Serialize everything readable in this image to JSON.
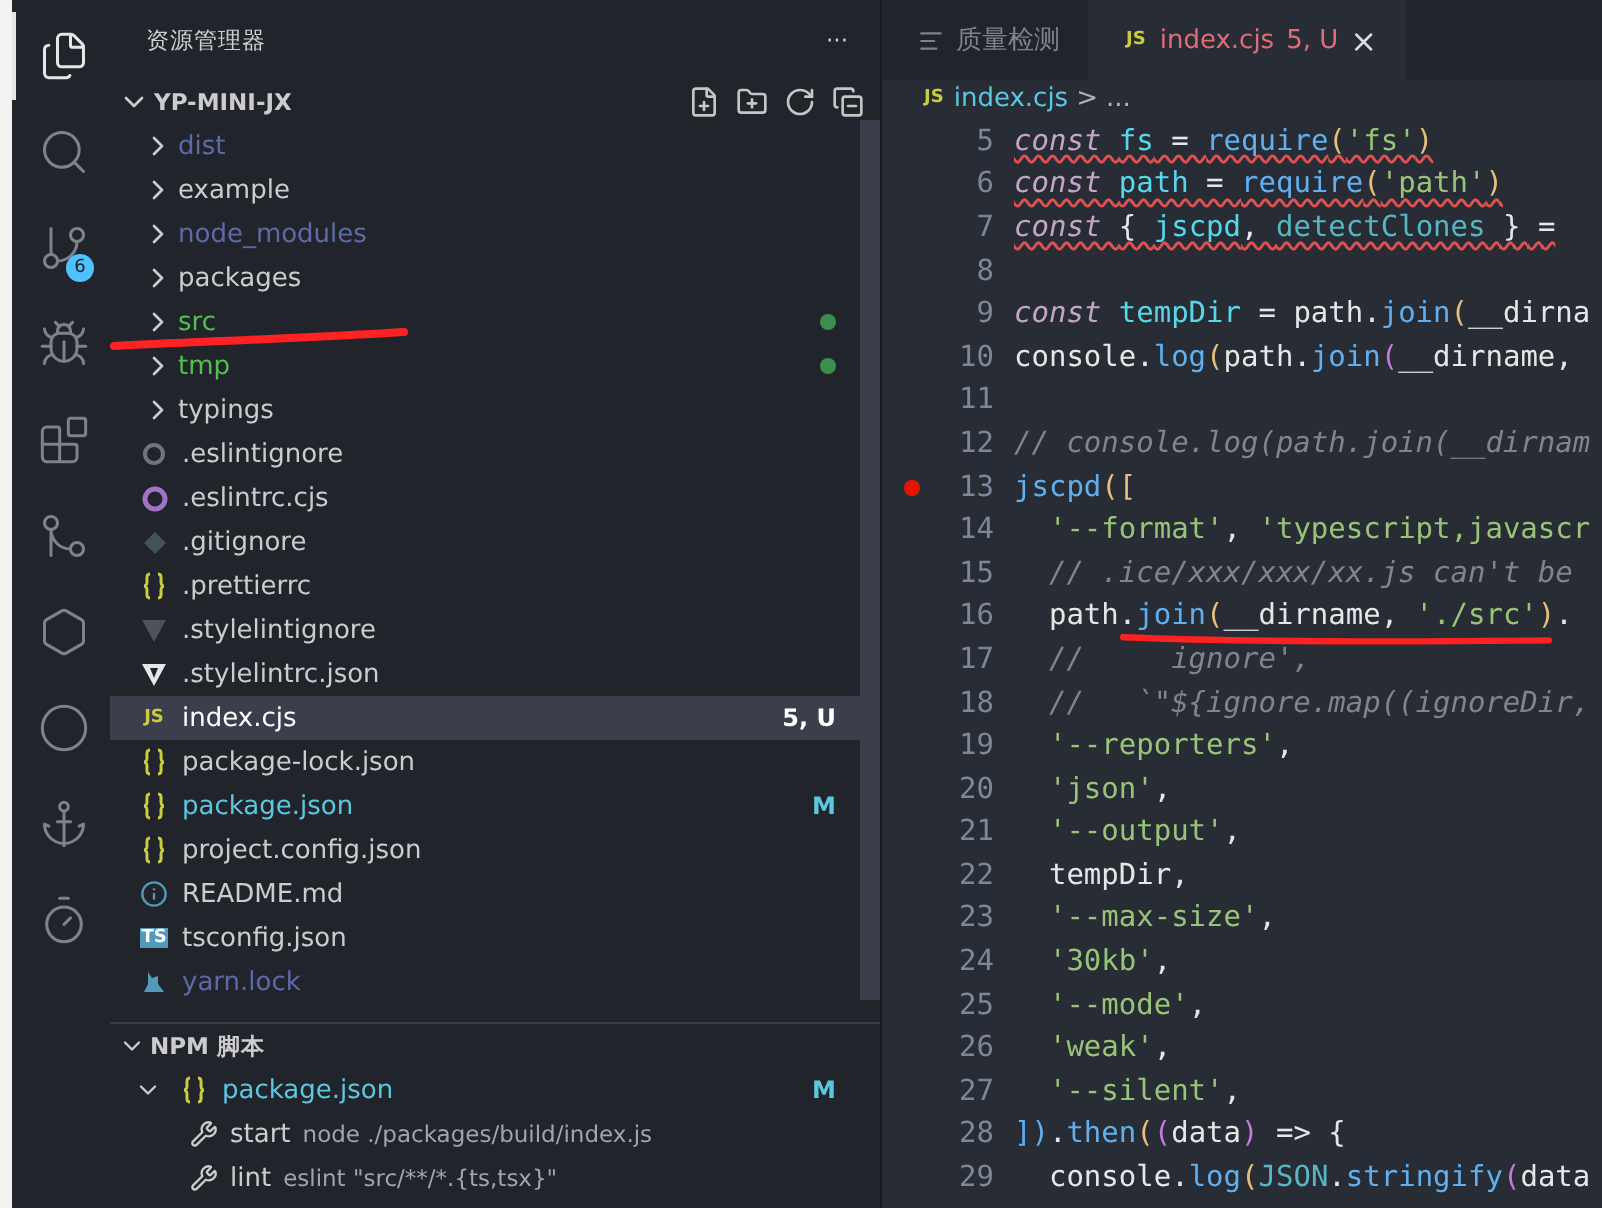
{
  "activity_bar": [
    {
      "kind": "files",
      "selected": true
    },
    {
      "kind": "search",
      "selected": false
    },
    {
      "kind": "source-control",
      "selected": false,
      "badge": "6"
    },
    {
      "kind": "run-debug",
      "selected": false
    },
    {
      "kind": "extensions",
      "selected": false
    },
    {
      "kind": "git-graph",
      "selected": false
    },
    {
      "kind": "knot",
      "selected": false
    },
    {
      "kind": "ring-logo",
      "selected": false
    },
    {
      "kind": "hook",
      "selected": false
    },
    {
      "kind": "timer",
      "selected": false
    }
  ],
  "sidebar": {
    "title": "资源管理器",
    "more": "···",
    "folder": {
      "name": "YP-MINI-JX",
      "expanded": true
    },
    "items": [
      {
        "kind": "folder",
        "name": "dist",
        "color": "#5c6ba7",
        "selected": false,
        "dot": false
      },
      {
        "kind": "folder",
        "name": "example",
        "color": "#cccccc",
        "selected": false,
        "dot": false
      },
      {
        "kind": "folder",
        "name": "node_modules",
        "color": "#5c6ba7",
        "selected": false,
        "dot": false
      },
      {
        "kind": "folder",
        "name": "packages",
        "color": "#cccccc",
        "selected": false,
        "dot": false
      },
      {
        "kind": "folder",
        "name": "src",
        "color": "#4ec24a",
        "selected": false,
        "dot": true
      },
      {
        "kind": "folder",
        "name": "tmp",
        "color": "#4ec24a",
        "selected": false,
        "dot": true
      },
      {
        "kind": "folder",
        "name": "typings",
        "color": "#cccccc",
        "selected": false,
        "dot": false
      },
      {
        "kind": "dot-ring",
        "name": ".eslintignore",
        "color": "#cccccc",
        "selected": false,
        "dot": false
      },
      {
        "kind": "hex-ring",
        "name": ".eslintrc.cjs",
        "color": "#cccccc",
        "selected": false,
        "dot": false
      },
      {
        "kind": "diamond",
        "name": ".gitignore",
        "color": "#cccccc",
        "selected": false,
        "dot": false
      },
      {
        "kind": "braces",
        "name": ".prettierrc",
        "color": "#cccccc",
        "selected": false,
        "dot": false
      },
      {
        "kind": "shield-dim",
        "name": ".stylelintignore",
        "color": "#cccccc",
        "selected": false,
        "dot": false
      },
      {
        "kind": "shield",
        "name": ".stylelintrc.json",
        "color": "#cccccc",
        "selected": false,
        "dot": false
      },
      {
        "kind": "js",
        "icon_label": "JS",
        "name": "index.cjs",
        "color": "#ffffff",
        "selected": true,
        "dot": false,
        "badge": "5, U"
      },
      {
        "kind": "braces",
        "name": "package-lock.json",
        "color": "#cccccc",
        "selected": false,
        "dot": false
      },
      {
        "kind": "braces",
        "name": "package.json",
        "color": "#5ac8e0",
        "selected": false,
        "dot": false,
        "badge": "M"
      },
      {
        "kind": "braces",
        "name": "project.config.json",
        "color": "#cccccc",
        "selected": false,
        "dot": false
      },
      {
        "kind": "info",
        "name": "README.md",
        "color": "#cccccc",
        "selected": false,
        "dot": false
      },
      {
        "kind": "ts",
        "icon_label": "TS",
        "name": "tsconfig.json",
        "color": "#cccccc",
        "selected": false,
        "dot": false
      },
      {
        "kind": "yarn",
        "name": "yarn.lock",
        "color": "#5c6ba7",
        "selected": false,
        "dot": false
      }
    ],
    "npm": {
      "title": "NPM 脚本",
      "expanded": true,
      "file": {
        "name": "package.json",
        "badge": "M",
        "expanded": true
      },
      "scripts": [
        {
          "name": "start",
          "command": "node ./packages/build/index.js"
        },
        {
          "name": "lint",
          "command": "eslint \"src/**/*.{ts,tsx}\""
        }
      ]
    }
  },
  "editor": {
    "tabs": [
      {
        "kind": "list",
        "label": "质量检测",
        "selected": false
      },
      {
        "kind": "js",
        "icon_label": "JS",
        "label": "index.cjs",
        "badge": "5, U",
        "close": "×",
        "selected": true
      }
    ],
    "breadcrumb": {
      "icon_label": "JS",
      "file": "index.cjs",
      "separator": ">",
      "rest": "..."
    },
    "lines": [
      {
        "number": "5",
        "breakpoint": false,
        "errors": true,
        "tokens": [
          {
            "kind": "keyword",
            "text": "const "
          },
          {
            "kind": "var",
            "text": "fs"
          },
          {
            "kind": "plain",
            "text": " = "
          },
          {
            "kind": "fn",
            "text": "require"
          },
          {
            "kind": "bracket",
            "text": "("
          },
          {
            "kind": "string",
            "text": "'fs'"
          },
          {
            "kind": "bracket",
            "text": ")"
          }
        ]
      },
      {
        "number": "6",
        "breakpoint": false,
        "errors": true,
        "tokens": [
          {
            "kind": "keyword",
            "text": "const "
          },
          {
            "kind": "var",
            "text": "path"
          },
          {
            "kind": "plain",
            "text": " = "
          },
          {
            "kind": "fn",
            "text": "require"
          },
          {
            "kind": "bracket",
            "text": "("
          },
          {
            "kind": "string",
            "text": "'path'"
          },
          {
            "kind": "bracket",
            "text": ")"
          }
        ]
      },
      {
        "number": "7",
        "breakpoint": false,
        "errors": true,
        "tokens": [
          {
            "kind": "keyword",
            "text": "const "
          },
          {
            "kind": "plain",
            "text": "{ "
          },
          {
            "kind": "var",
            "text": "jscpd"
          },
          {
            "kind": "plain",
            "text": ", "
          },
          {
            "kind": "type",
            "text": "detectClones"
          },
          {
            "kind": "plain",
            "text": " } ="
          }
        ]
      },
      {
        "number": "8",
        "breakpoint": false
      },
      {
        "number": "9",
        "breakpoint": false,
        "errors": false,
        "tokens": [
          {
            "kind": "keyword",
            "text": "const "
          },
          {
            "kind": "var",
            "text": "tempDir"
          },
          {
            "kind": "plain",
            "text": " = path."
          },
          {
            "kind": "fn",
            "text": "join"
          },
          {
            "kind": "bracket",
            "text": "("
          },
          {
            "kind": "plain",
            "text": "__dirna"
          }
        ]
      },
      {
        "number": "10",
        "breakpoint": false,
        "errors": false,
        "tokens": [
          {
            "kind": "plain",
            "text": "console."
          },
          {
            "kind": "fn",
            "text": "log"
          },
          {
            "kind": "bracket",
            "text": "("
          },
          {
            "kind": "plain",
            "text": "path."
          },
          {
            "kind": "fn",
            "text": "join"
          },
          {
            "kind": "bracket2",
            "text": "("
          },
          {
            "kind": "plain",
            "text": "__dirname,"
          }
        ]
      },
      {
        "number": "11",
        "breakpoint": false
      },
      {
        "number": "12",
        "breakpoint": false,
        "errors": false,
        "tokens": [
          {
            "kind": "comment",
            "text": "// console.log(path.join(__dirnam"
          }
        ]
      },
      {
        "number": "13",
        "breakpoint": true,
        "errors": false,
        "tokens": [
          {
            "kind": "fn",
            "text": "jscpd"
          },
          {
            "kind": "bracket",
            "text": "(["
          }
        ]
      },
      {
        "number": "14",
        "breakpoint": false,
        "errors": false,
        "tokens": [
          {
            "kind": "string",
            "text": "  '--format'"
          },
          {
            "kind": "plain",
            "text": ", "
          },
          {
            "kind": "string",
            "text": "'typescript,javascr"
          }
        ]
      },
      {
        "number": "15",
        "breakpoint": false,
        "errors": false,
        "tokens": [
          {
            "kind": "comment",
            "text": "  // .ice/xxx/xxx/xx.js can't be"
          }
        ]
      },
      {
        "number": "16",
        "breakpoint": false,
        "errors": false,
        "tokens": [
          {
            "kind": "plain",
            "text": "  path."
          },
          {
            "kind": "fn",
            "text": "join"
          },
          {
            "kind": "bracket",
            "text": "("
          },
          {
            "kind": "plain",
            "text": "__dirname, "
          },
          {
            "kind": "string",
            "text": "'./src'"
          },
          {
            "kind": "bracket",
            "text": ")"
          },
          {
            "kind": "plain",
            "text": "."
          }
        ]
      },
      {
        "number": "17",
        "breakpoint": false,
        "errors": false,
        "tokens": [
          {
            "kind": "comment",
            "text": "  //     ignore',"
          }
        ]
      },
      {
        "number": "18",
        "breakpoint": false,
        "errors": false,
        "tokens": [
          {
            "kind": "comment",
            "text": "  //   `\"${ignore.map((ignoreDir,"
          }
        ]
      },
      {
        "number": "19",
        "breakpoint": false,
        "errors": false,
        "tokens": [
          {
            "kind": "string",
            "text": "  '--reporters'"
          },
          {
            "kind": "plain",
            "text": ","
          }
        ]
      },
      {
        "number": "20",
        "breakpoint": false,
        "errors": false,
        "tokens": [
          {
            "kind": "string",
            "text": "  'json'"
          },
          {
            "kind": "plain",
            "text": ","
          }
        ]
      },
      {
        "number": "21",
        "breakpoint": false,
        "errors": false,
        "tokens": [
          {
            "kind": "string",
            "text": "  '--output'"
          },
          {
            "kind": "plain",
            "text": ","
          }
        ]
      },
      {
        "number": "22",
        "breakpoint": false,
        "errors": false,
        "tokens": [
          {
            "kind": "plain",
            "text": "  tempDir,"
          }
        ]
      },
      {
        "number": "23",
        "breakpoint": false,
        "errors": false,
        "tokens": [
          {
            "kind": "string",
            "text": "  '--max-size'"
          },
          {
            "kind": "plain",
            "text": ","
          }
        ]
      },
      {
        "number": "24",
        "breakpoint": false,
        "errors": false,
        "tokens": [
          {
            "kind": "string",
            "text": "  '30kb'"
          },
          {
            "kind": "plain",
            "text": ","
          }
        ]
      },
      {
        "number": "25",
        "breakpoint": false,
        "errors": false,
        "tokens": [
          {
            "kind": "string",
            "text": "  '--mode'"
          },
          {
            "kind": "plain",
            "text": ","
          }
        ]
      },
      {
        "number": "26",
        "breakpoint": false,
        "errors": false,
        "tokens": [
          {
            "kind": "string",
            "text": "  'weak'"
          },
          {
            "kind": "plain",
            "text": ","
          }
        ]
      },
      {
        "number": "27",
        "breakpoint": false,
        "errors": false,
        "tokens": [
          {
            "kind": "string",
            "text": "  '--silent'"
          },
          {
            "kind": "plain",
            "text": ","
          }
        ]
      },
      {
        "number": "28",
        "breakpoint": false,
        "errors": false,
        "tokens": [
          {
            "kind": "bracket3",
            "text": "])"
          },
          {
            "kind": "plain",
            "text": "."
          },
          {
            "kind": "fn",
            "text": "then"
          },
          {
            "kind": "bracket",
            "text": "("
          },
          {
            "kind": "bracket2",
            "text": "("
          },
          {
            "kind": "plain",
            "text": "data"
          },
          {
            "kind": "bracket2",
            "text": ")"
          },
          {
            "kind": "plain",
            "text": " => {"
          }
        ]
      },
      {
        "number": "29",
        "breakpoint": false,
        "errors": false,
        "tokens": [
          {
            "kind": "plain",
            "text": "  console."
          },
          {
            "kind": "fn",
            "text": "log"
          },
          {
            "kind": "bracket",
            "text": "("
          },
          {
            "kind": "type",
            "text": "JSON"
          },
          {
            "kind": "plain",
            "text": "."
          },
          {
            "kind": "fn",
            "text": "stringify"
          },
          {
            "kind": "bracket2",
            "text": "("
          },
          {
            "kind": "plain",
            "text": "data"
          }
        ]
      }
    ]
  }
}
